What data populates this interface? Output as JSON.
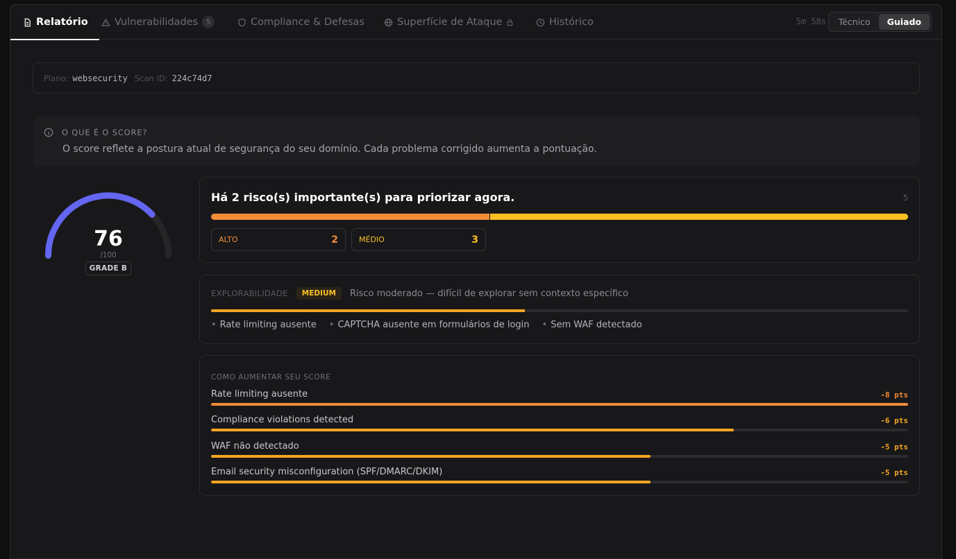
{
  "tabs": [
    {
      "label": "Relatório"
    },
    {
      "label": "Vulnerabilidades",
      "badge": "5"
    },
    {
      "label": "Compliance & Defesas"
    },
    {
      "label": "Superfície de Ataque"
    },
    {
      "label": "Histórico"
    }
  ],
  "timer": "5m 58s",
  "modes": {
    "tecnico": "Técnico",
    "guiado": "Guiado",
    "selected": "Guiado"
  },
  "plan": {
    "plan_label": "Plano:",
    "plan_value": "websecurity",
    "scan_label": "Scan ID:",
    "scan_value": "224c74d7"
  },
  "info": {
    "title": "O QUE É O SCORE?",
    "body": "O score reflete a postura atual de segurança do seu domínio. Cada problema corrigido aumenta a pontuação."
  },
  "gauge": {
    "score": 76,
    "max_label": "/100",
    "max": 100,
    "grade": "GRADE B",
    "color": "#6366f1"
  },
  "risk": {
    "title": "Há 2 risco(s) importante(s) para priorizar agora.",
    "total": "5",
    "alto": {
      "label": "ALTO",
      "count": 2,
      "color": "#f28c38"
    },
    "medio": {
      "label": "MÉDIO",
      "count": 3,
      "color": "#fbbf24"
    }
  },
  "explorability": {
    "label": "EXPLORABILIDADE",
    "level": "MEDIUM",
    "description": "Risco moderado — difícil de explorar sem contexto específico",
    "fill_fraction": 0.45,
    "factors": [
      "Rate limiting ausente",
      "CAPTCHA ausente em formulários de login",
      "Sem WAF detectado"
    ]
  },
  "improve": {
    "title": "COMO AUMENTAR SEU SCORE",
    "items": [
      {
        "label": "Rate limiting ausente",
        "points": "-8 pts",
        "fraction": 1.0
      },
      {
        "label": "Compliance violations detected",
        "points": "-6 pts",
        "fraction": 0.75
      },
      {
        "label": "WAF não detectado",
        "points": "-5 pts",
        "fraction": 0.63
      },
      {
        "label": "Email security misconfiguration (SPF/DMARC/DKIM)",
        "points": "-5 pts",
        "fraction": 0.63
      }
    ]
  }
}
